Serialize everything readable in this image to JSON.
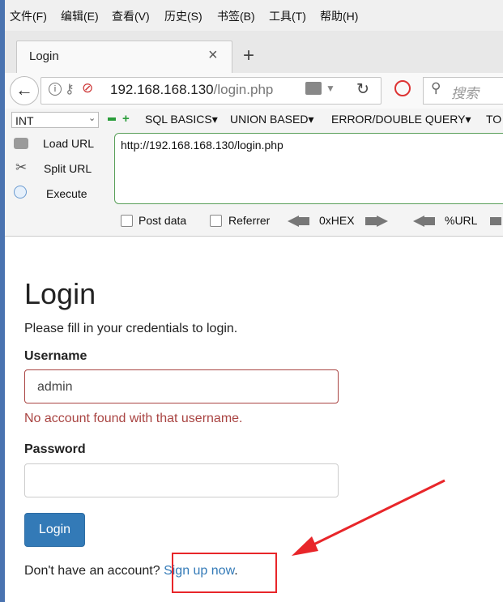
{
  "menubar": {
    "items": [
      "文件(F)",
      "编辑(E)",
      "查看(V)",
      "历史(S)",
      "书签(B)",
      "工具(T)",
      "帮助(H)"
    ]
  },
  "tab": {
    "title": "Login",
    "close": "×",
    "newtab": "+"
  },
  "nav": {
    "url_host": "192.168.168.130",
    "url_path": "/login.php",
    "search_placeholder": "搜索"
  },
  "hackbar": {
    "select_value": "INT",
    "menus": [
      "SQL BASICS",
      "UNION BASED",
      "ERROR/DOUBLE QUERY",
      "TO"
    ],
    "side": [
      "Load URL",
      "Split URL",
      "Execute"
    ],
    "textarea": "http://192.168.168.130/login.php",
    "checks": [
      "Post data",
      "Referrer"
    ],
    "encoders": [
      "0xHEX",
      "%URL"
    ]
  },
  "page": {
    "title": "Login",
    "subtitle": "Please fill in your credentials to login.",
    "username_label": "Username",
    "username_value": "admin",
    "username_error": "No account found with that username.",
    "password_label": "Password",
    "login_button": "Login",
    "signup_prefix": "Don't have an account? ",
    "signup_link": "Sign up now",
    "signup_suffix": "."
  },
  "colors": {
    "brand_button": "#337ab7",
    "error": "#a94442",
    "annotation": "#e8262a"
  }
}
